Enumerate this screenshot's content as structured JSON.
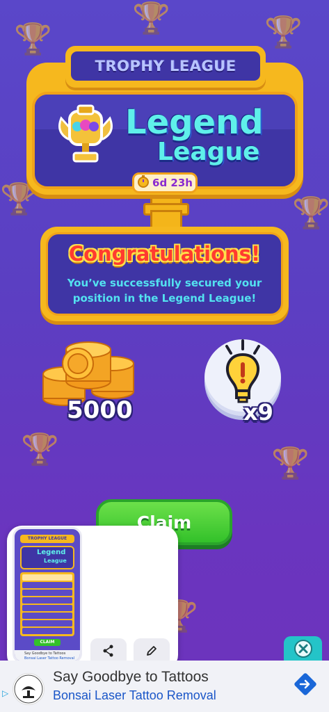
{
  "header": {
    "title": "TROPHY LEAGUE"
  },
  "league": {
    "line1": "Legend",
    "line2": "League",
    "timer": "6d 23h"
  },
  "congrats": {
    "title": "Congratulations!",
    "message_line1": "You’ve successfully secured your",
    "message_line2": "position in the Legend League!"
  },
  "rewards": {
    "coins": "5000",
    "hints": "x9"
  },
  "claim": {
    "label": "Claim"
  },
  "preview": {
    "title": "TROPHY LEAGUE",
    "league_line1": "Legend",
    "league_line2": "League",
    "claim_label": "CLAIM",
    "ad_text": "Say Goodbye to Tattoos",
    "ad_sub": "Bonsai Laser Tattoo Removal"
  },
  "ad": {
    "line1": "Say Goodbye to Tattoos",
    "line2": "Bonsai Laser Tattoo Removal"
  },
  "icons": {
    "trophy": "trophy-icon",
    "timer": "stopwatch-icon",
    "coins": "coin-stack-icon",
    "hint": "lightbulb-icon",
    "share": "share-icon",
    "edit": "pencil-icon",
    "close": "close-icon",
    "arrow": "arrow-right-icon"
  },
  "colors": {
    "accent_gold": "#f6b81e",
    "panel_purple": "#3f35a5",
    "league_cyan": "#5ff0ea",
    "congrats_red": "#ff3b2f",
    "claim_green": "#33c12a",
    "close_teal": "#24c4c8"
  }
}
